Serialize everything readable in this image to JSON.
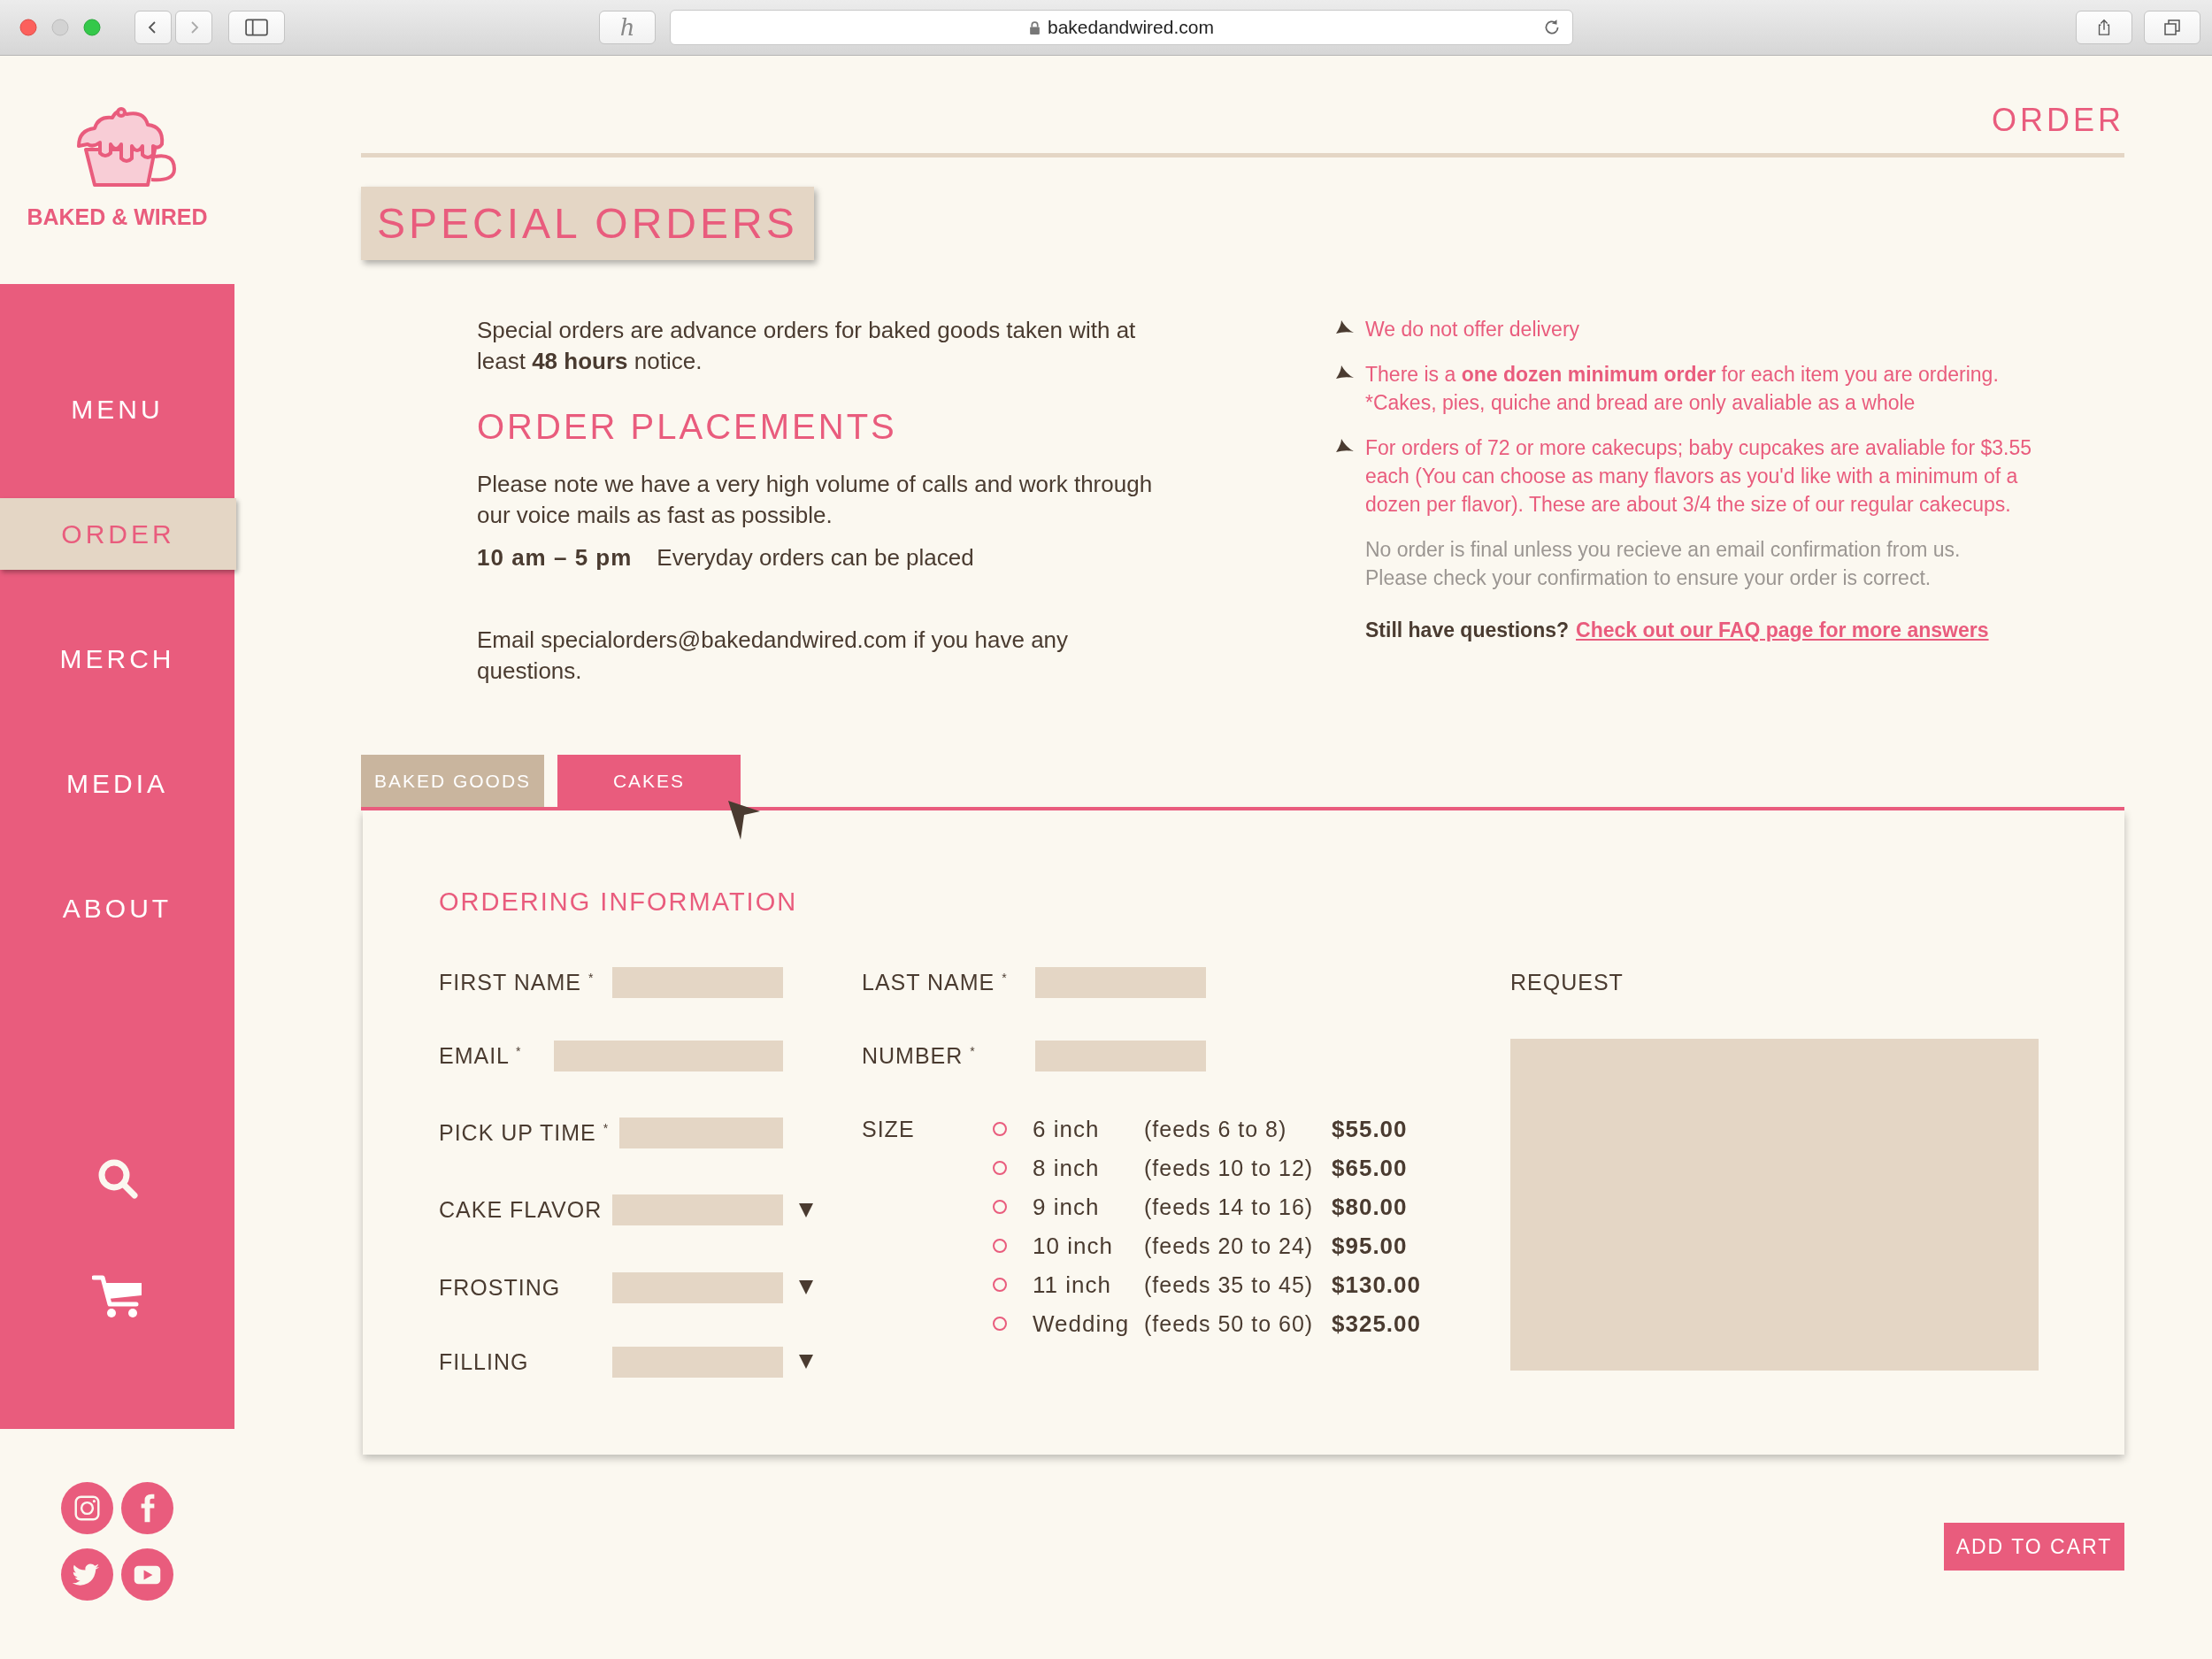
{
  "browser": {
    "extension": "h",
    "url": "bakedandwired.com"
  },
  "logo": {
    "text": "BAKED & WIRED"
  },
  "nav": [
    {
      "label": "MENU",
      "selected": false
    },
    {
      "label": "ORDER",
      "selected": true
    },
    {
      "label": "MERCH",
      "selected": false
    },
    {
      "label": "MEDIA",
      "selected": false
    },
    {
      "label": "ABOUT",
      "selected": false
    }
  ],
  "header": {
    "title": "ORDER"
  },
  "page_title": "SPECIAL ORDERS",
  "intro": "Special orders are advance orders for baked goods taken with at least **48 hours** notice.",
  "placements": {
    "heading": "ORDER PLACEMENTS",
    "note": "Please note we have a very high volume of calls and work through our voice mails as fast as possible.",
    "hours": "10 am – 5 pm",
    "hours_note": "Everyday orders can be placed",
    "email_note": "Email specialorders@bakedandwired.com if you have any questions."
  },
  "notices": [
    {
      "lines": [
        "We do not offer delivery"
      ]
    },
    {
      "lines": [
        "There is a **one dozen minimum order** for each item you are ordering.",
        "*Cakes, pies, quiche and bread are only avaliable as a whole"
      ]
    },
    {
      "lines": [
        "For orders of 72 or more cakecups; baby cupcakes are avaliable for $3.55 each (You can choose as many flavors as you'd like with a minimum of a dozen per flavor). These are about 3/4 the size of our regular cakecups."
      ]
    }
  ],
  "disclaimer": [
    "No order is final unless you recieve an email confirmation from us.",
    "Please check your confirmation to ensure your order is correct."
  ],
  "faq": {
    "question": "Still have questions?",
    "link": "Check out our FAQ page for more answers"
  },
  "tabs": [
    {
      "label": "BAKED GOODS",
      "selected": false
    },
    {
      "label": "CAKES",
      "selected": true
    }
  ],
  "form": {
    "title": "ORDERING INFORMATION",
    "contact_fields": [
      {
        "label": "FIRST NAME $^{*}$",
        "kind": "text"
      },
      {
        "label": "LAST NAME $^{*}$",
        "kind": "text"
      },
      {
        "label": "EMAIL $^{*}$",
        "kind": "email"
      },
      {
        "label": "NUMBER $^{*}$",
        "kind": "text"
      }
    ],
    "order_fields": [
      {
        "label": "PICK UP TIME $^{*}$",
        "kind": "text"
      },
      {
        "label": "CAKE FLAVOR",
        "kind": "select"
      },
      {
        "label": "FROSTING",
        "kind": "select"
      },
      {
        "label": "FILLING",
        "kind": "select"
      }
    ],
    "size": {
      "label": "SIZE",
      "options": [
        {
          "size": "6 inch",
          "feeds": "(feeds 6 to 8)",
          "price": "$55.00",
          "selected": false
        },
        {
          "size": "8 inch",
          "feeds": "(feeds 10 to 12)",
          "price": "$65.00",
          "selected": false
        },
        {
          "size": "9 inch",
          "feeds": "(feeds 14 to 16)",
          "price": "$80.00",
          "selected": false
        },
        {
          "size": "10 inch",
          "feeds": "(feeds 20 to 24)",
          "price": "$95.00",
          "selected": false
        },
        {
          "size": "11 inch",
          "feeds": "(feeds 35 to 45)",
          "price": "$130.00",
          "selected": false
        },
        {
          "size": "Wedding",
          "feeds": "(feeds 50 to 60)",
          "price": "$325.00",
          "selected": false
        }
      ]
    },
    "request": {
      "label": "REQUEST"
    }
  },
  "add_to_cart": "ADD TO CART"
}
